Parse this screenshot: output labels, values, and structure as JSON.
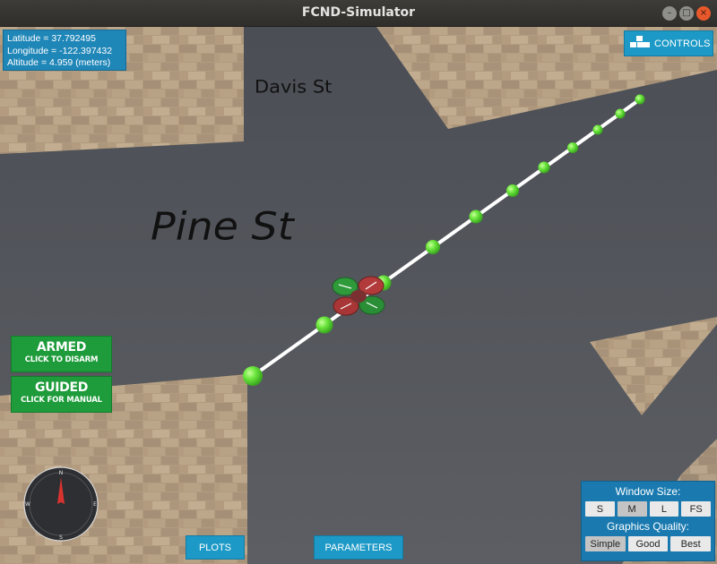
{
  "window": {
    "title": "FCND-Simulator",
    "minimize_glyph": "–",
    "maximize_glyph": "□",
    "close_glyph": "×"
  },
  "telemetry": {
    "latitude": "Latitude = 37.792495",
    "longitude": "Longitude = -122.397432",
    "altitude": "Altitude = 4.959 (meters)"
  },
  "controls_button": {
    "label": "CONTROLS",
    "icon": "blocks-icon"
  },
  "street_labels": {
    "davis": "Davis St",
    "pine": "Pine St"
  },
  "state_buttons": {
    "armed": {
      "title": "ARMED",
      "subtitle": "CLICK TO DISARM"
    },
    "guided": {
      "title": "GUIDED",
      "subtitle": "CLICK FOR MANUAL"
    }
  },
  "compass": {
    "n": "N",
    "e": "E",
    "s": "S",
    "w": "W",
    "icon": "compass-icon"
  },
  "bottom_buttons": {
    "plots": "PLOTS",
    "parameters": "PARAMETERS"
  },
  "settings": {
    "window_size_label": "Window Size:",
    "window_sizes": [
      "S",
      "M",
      "L",
      "FS"
    ],
    "window_size_selected": "M",
    "graphics_label": "Graphics Quality:",
    "graphics_options": [
      "Simple",
      "Good",
      "Best"
    ],
    "graphics_selected": "Simple"
  },
  "colors": {
    "panel_blue": "#1c99c6",
    "armed_green": "#1e9b3a",
    "waypoint_green": "#5fe53a",
    "road_gray": "#55575c",
    "pavement": "#b49d80"
  }
}
